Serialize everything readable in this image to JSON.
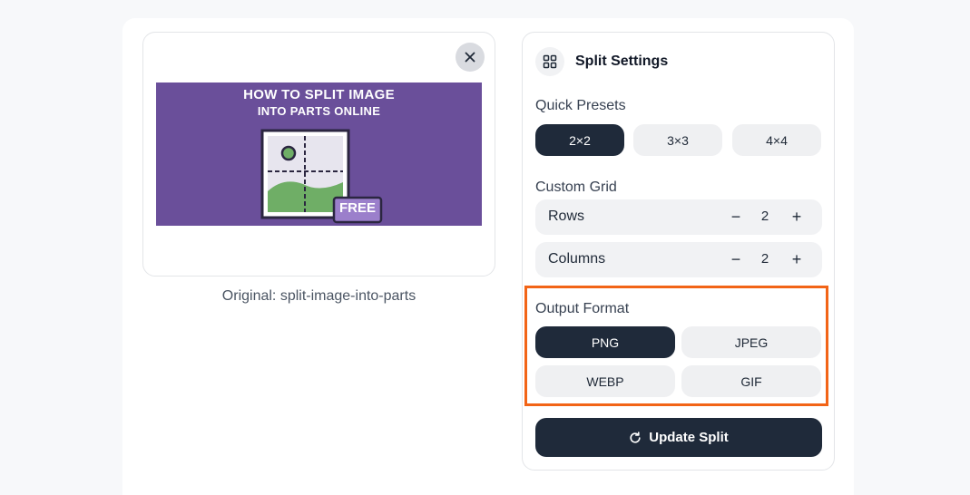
{
  "preview": {
    "image_title_line1": "HOW TO SPLIT IMAGE",
    "image_title_line2": "INTO PARTS ONLINE",
    "badge": "FREE",
    "caption": "Original: split-image-into-parts"
  },
  "settings": {
    "title": "Split Settings",
    "quick_presets_label": "Quick Presets",
    "presets": [
      "2×2",
      "3×3",
      "4×4"
    ],
    "custom_grid_label": "Custom Grid",
    "rows_label": "Rows",
    "rows_value": "2",
    "columns_label": "Columns",
    "columns_value": "2",
    "minus": "−",
    "plus": "+",
    "output_format_label": "Output Format",
    "formats": [
      "PNG",
      "JPEG",
      "WEBP",
      "GIF"
    ],
    "update_label": "Update Split"
  },
  "colors": {
    "accent_dark": "#1f2a3a",
    "highlight": "#f26417",
    "thumb_bg": "#6a4f9a"
  }
}
